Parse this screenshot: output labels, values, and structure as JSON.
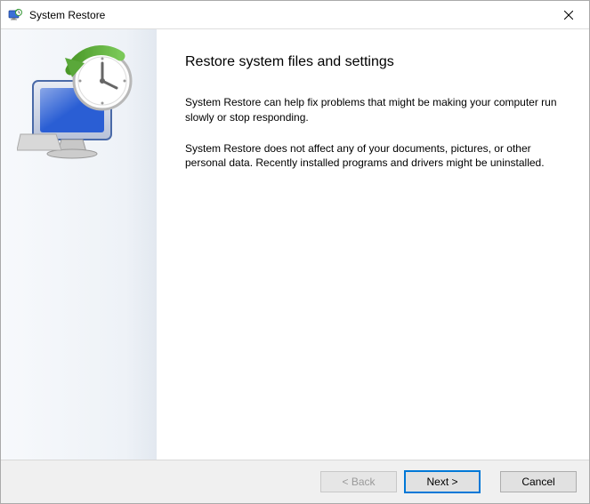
{
  "window": {
    "title": "System Restore"
  },
  "main": {
    "heading": "Restore system files and settings",
    "paragraph1": "System Restore can help fix problems that might be making your computer run slowly or stop responding.",
    "paragraph2": "System Restore does not affect any of your documents, pictures, or other personal data. Recently installed programs and drivers might be uninstalled."
  },
  "buttons": {
    "back": "< Back",
    "next": "Next >",
    "cancel": "Cancel"
  },
  "icons": {
    "app": "system-restore-icon",
    "close": "close-icon",
    "sidebar": "monitor-clock-restore-icon"
  }
}
